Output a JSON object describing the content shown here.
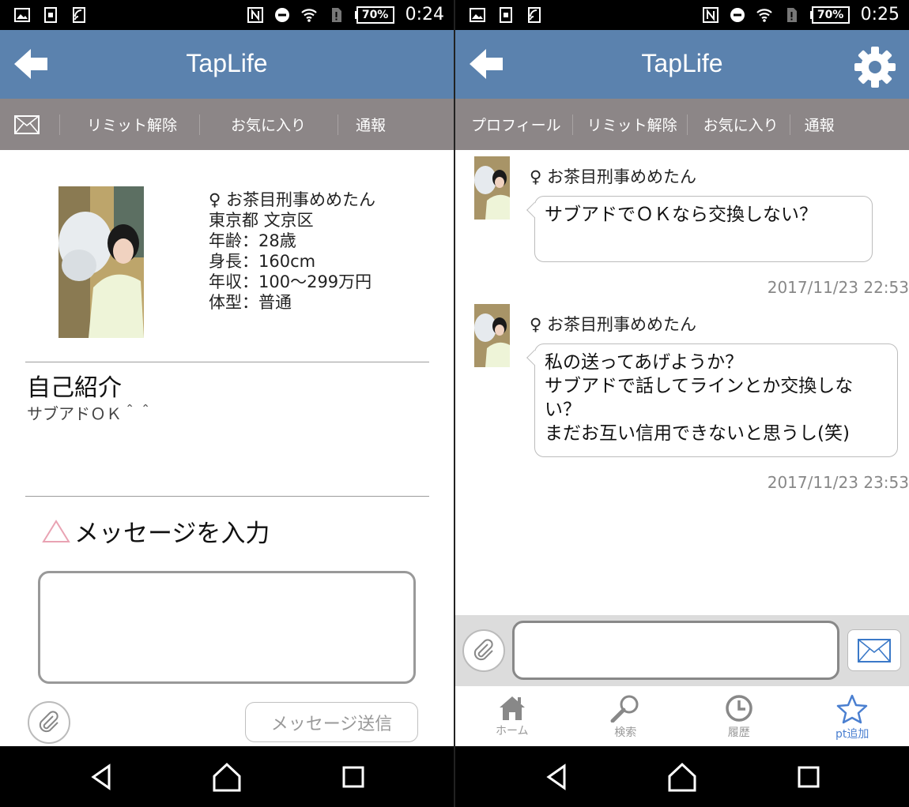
{
  "app": {
    "title": "TapLife"
  },
  "colors": {
    "appbar": "#5b82ae",
    "tabbar": "#8c8687",
    "accent_star": "#4a7fd0",
    "pink_triangle": "#e9a3b3"
  },
  "status_left": {
    "time": "0:24",
    "battery": "70%"
  },
  "status_right": {
    "time": "0:25",
    "battery": "70%"
  },
  "left_tabs": {
    "mail_icon": "mail-icon",
    "items": [
      "リミット解除",
      "お気に入り",
      "通報"
    ]
  },
  "right_tabs": {
    "items": [
      "プロフィール",
      "リミット解除",
      "お気に入り",
      "通報"
    ]
  },
  "profile": {
    "name_line": "♀ お茶目刑事めめたん",
    "location": "東京都 文京区",
    "age": "年齢：28歳",
    "height": "身長：160cm",
    "income": "年収：100〜299万円",
    "body": "体型：普通"
  },
  "intro": {
    "title": "自己紹介",
    "text": "サブアドＯＫ＾＾"
  },
  "message_form": {
    "heading": "メッセージを入力",
    "textarea_value": "",
    "send_label": "メッセージ送信"
  },
  "chat": {
    "messages": [
      {
        "sender": "♀ お茶目刑事めめたん",
        "lines": [
          "サブアドでＯＫなら交換しない？"
        ],
        "time": "2017/11/23 22:53"
      },
      {
        "sender": "♀ お茶目刑事めめたん",
        "lines": [
          "私の送ってあげようか？",
          "サブアドで話してラインとか交換しな",
          "い？",
          "まだお互い信用できないと思うし(笑)"
        ],
        "time": "2017/11/23 23:53"
      }
    ],
    "input_value": ""
  },
  "bottom_nav": [
    {
      "label": "ホーム",
      "icon": "home-icon"
    },
    {
      "label": "検索",
      "icon": "search-icon"
    },
    {
      "label": "履歴",
      "icon": "clock-icon"
    },
    {
      "label": "pt追加",
      "icon": "star-icon"
    }
  ]
}
